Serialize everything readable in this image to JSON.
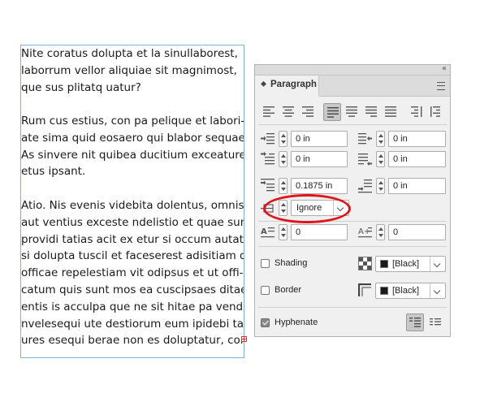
{
  "text_frame": {
    "paragraphs": [
      [
        "Nite coratus dolupta et la sinullaborest,",
        "laborrum vellor aliquiae sit magnimost,",
        "que sus plitatq uatur?"
      ],
      [
        "Rum cus estius, con pa pelique et labori-",
        "ate sima quid eosaero qui blabor sequae.",
        "As sinvere nit quibea ducitium exceature",
        "etus ipsant."
      ],
      [
        "Atio. Nis evenis videbita dolentus, omnis ea",
        "aut ventius exceste ndelistio et quae sunt",
        "providi tatias acit ex etur si occum autatur,",
        "si dolupta tuscil et faceserest adisitiam dit",
        "officae repelestiam vit odipsus et ut offi-",
        "catum quis sunt mos ea cuscipsaes ditae",
        "entis is acculpa que ne sit hitae pa venditi",
        "nvelesequi ute destiorum eum ipidebi tat-",
        "ures esequi berae non es doluptatur, con"
      ]
    ]
  },
  "panel": {
    "collapse_icon": "double-chevron-right-icon",
    "tab_label": "Paragraph",
    "menu_icon": "panel-menu-icon",
    "alignment_buttons": [
      {
        "name": "align-left-button",
        "active": false
      },
      {
        "name": "align-center-button",
        "active": false
      },
      {
        "name": "align-right-button",
        "active": false
      },
      {
        "name": "justify-last-left-button",
        "active": true
      },
      {
        "name": "justify-last-center-button",
        "active": false
      },
      {
        "name": "justify-last-right-button",
        "active": false
      },
      {
        "name": "justify-all-button",
        "active": false
      },
      {
        "name": "align-towards-spine-button",
        "active": false
      },
      {
        "name": "align-away-from-spine-button",
        "active": false
      }
    ],
    "fields": {
      "left_indent": "0 in",
      "right_indent": "0 in",
      "first_line_indent": "0 in",
      "last_line_right_indent": "0 in",
      "space_before": "0.1875 in",
      "space_after": "0 in",
      "align_to_grid": "Ignore",
      "drop_cap_lines": "0",
      "drop_cap_chars": "0"
    },
    "shading": {
      "label": "Shading",
      "checked": false,
      "color": "[Black]"
    },
    "border": {
      "label": "Border",
      "checked": false,
      "color": "[Black]"
    },
    "hyphenate": {
      "label": "Hyphenate",
      "checked": true
    },
    "accent_color": "#e0141b"
  }
}
